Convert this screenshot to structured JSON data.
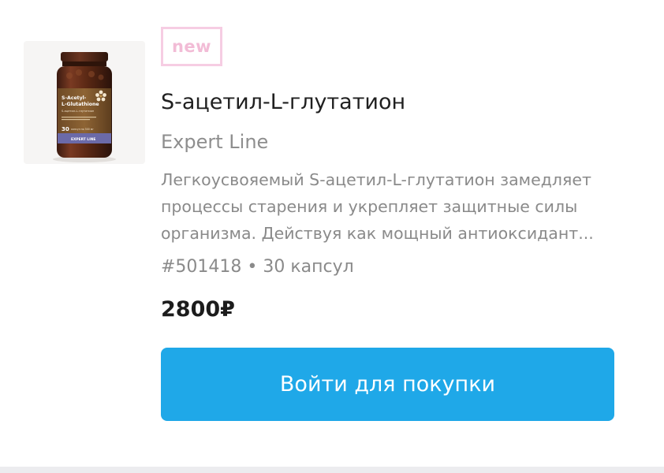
{
  "product": {
    "badge": "new",
    "title": "S-ацетил-L-глутатион",
    "brand": "Expert Line",
    "description": "Легкоусвояемый S-ацетил-L-глутатион замедляет процессы старения и укрепляет защитные силы организма. Действуя как мощный антиоксидант...",
    "sku": "#501418",
    "separator": "•",
    "quantity": "30 капсул",
    "price": "2800₽",
    "image": {
      "label_line1": "S-Acetyl-",
      "label_line2": "L-Glutathione",
      "label_subtitle": "S-ацетил-L-глутатион",
      "label_count": "30",
      "label_count_unit": "капсул по 500 мг",
      "label_brand": "EXPERT LINE"
    }
  },
  "actions": {
    "buy_label": "Войти для покупки"
  },
  "colors": {
    "accent": "#1fa8e8",
    "badge": "#f6cde3",
    "title": "#202020",
    "muted": "#8a8a8a"
  }
}
